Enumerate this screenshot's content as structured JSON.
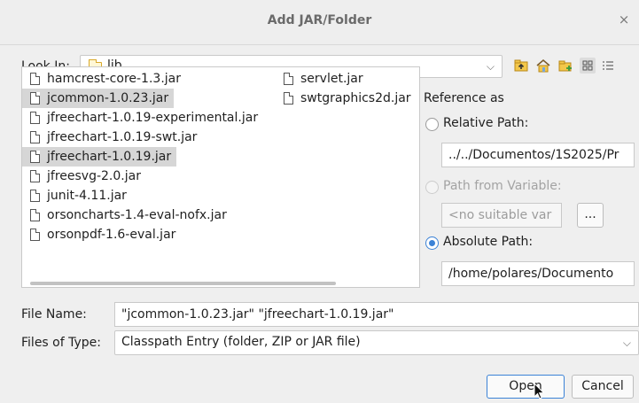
{
  "window": {
    "title": "Add JAR/Folder",
    "close_glyph": "×"
  },
  "lookin": {
    "label": "Look In:",
    "value": "lib",
    "icon": "folder-icon"
  },
  "toolbar": {
    "icons": [
      "up-folder-icon",
      "home-icon",
      "new-folder-icon",
      "list-view-icon",
      "details-view-icon"
    ]
  },
  "files": {
    "column1": [
      {
        "name": "hamcrest-core-1.3.jar",
        "selected": false
      },
      {
        "name": "jcommon-1.0.23.jar",
        "selected": true
      },
      {
        "name": "jfreechart-1.0.19-experimental.jar",
        "selected": false
      },
      {
        "name": "jfreechart-1.0.19-swt.jar",
        "selected": false
      },
      {
        "name": "jfreechart-1.0.19.jar",
        "selected": true
      },
      {
        "name": "jfreesvg-2.0.jar",
        "selected": false
      },
      {
        "name": "junit-4.11.jar",
        "selected": false
      },
      {
        "name": "orsoncharts-1.4-eval-nofx.jar",
        "selected": false
      },
      {
        "name": "orsonpdf-1.6-eval.jar",
        "selected": false
      }
    ],
    "column2": [
      {
        "name": "servlet.jar",
        "selected": false
      },
      {
        "name": "swtgraphics2d.jar",
        "selected": false
      }
    ]
  },
  "reference": {
    "heading": "Reference as",
    "relative_label": "Relative Path:",
    "relative_value": "../../Documentos/1S2025/Pr",
    "variable_label": "Path from Variable:",
    "variable_value": "<no suitable var",
    "variable_button": "...",
    "absolute_label": "Absolute Path:",
    "absolute_value": "/home/polares/Documento",
    "selected": "absolute"
  },
  "filename": {
    "label": "File Name:",
    "value": "\"jcommon-1.0.23.jar\" \"jfreechart-1.0.19.jar\""
  },
  "filetype": {
    "label": "Files of Type:",
    "value": "Classpath Entry (folder, ZIP or JAR file)"
  },
  "buttons": {
    "open": "Open",
    "cancel": "Cancel"
  },
  "colors": {
    "accent": "#3b82d6",
    "folder": "#d9a92b",
    "selection": "#d6d6d6"
  }
}
